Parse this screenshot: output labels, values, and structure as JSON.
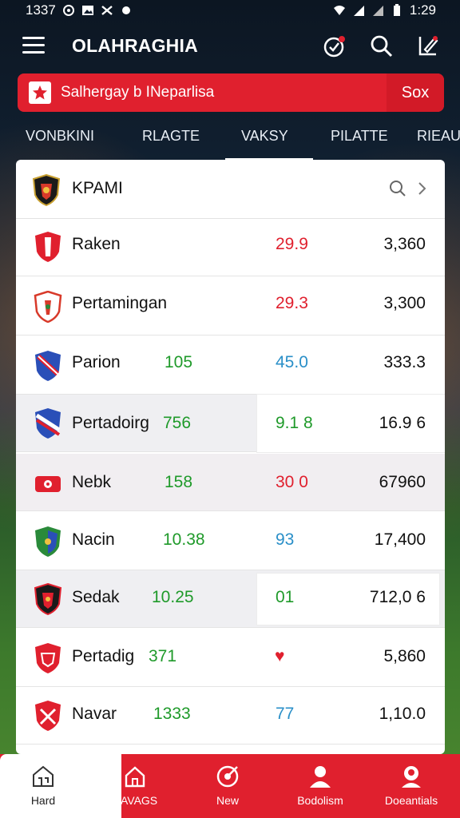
{
  "status_bar": {
    "time_left": "1337",
    "time_right": "1:29"
  },
  "app_bar": {
    "title": "OLAHRAGHIA"
  },
  "banner": {
    "text": "Salhergay b INeparlisa",
    "action": "Sox"
  },
  "tabs": [
    "VONBKINI",
    "RLAGTE",
    "VAKSY",
    "PILATTE",
    "RIEAU"
  ],
  "card_header": {
    "name": "KPAMI"
  },
  "rows": [
    {
      "team": "Raken",
      "v1": "",
      "v2": "29.9",
      "v3": "3,360",
      "v2_color": "red",
      "v3_color": "red"
    },
    {
      "team": "Pertamingan",
      "v1": "",
      "v2": "29.3",
      "v3": "3,300",
      "v2_color": "red",
      "v3_color": "green"
    },
    {
      "team": "Parion",
      "v1": "105",
      "v2": "45.0",
      "v3": "333.3",
      "v2_color": "blue",
      "v3_color": "black"
    },
    {
      "team": "Pertadoirg",
      "v1": "756",
      "v2": "9.1 8",
      "v3": "16.9 6",
      "v2_color": "green",
      "v3_color": "black"
    },
    {
      "team": "Nebk",
      "v1": "158",
      "v2": "30 0",
      "v3": "67960",
      "v2_color": "red",
      "v3_color": "black"
    },
    {
      "team": "Nacin",
      "v1": "10.38",
      "v2": "93",
      "v3": "17,400",
      "v2_color": "blue",
      "v3_color": "black"
    },
    {
      "team": "Sedak",
      "v1": "10.25",
      "v2": "01",
      "v3": "712,0 6",
      "v2_color": "green",
      "v3_color": "black"
    },
    {
      "team": "Pertadig",
      "v1": "371",
      "v2": "♥",
      "v3": "5,860",
      "v2_color": "red",
      "v3_color": "black"
    },
    {
      "team": "Navar",
      "v1": "1333",
      "v2": "77",
      "v3": "1,10.0",
      "v2_color": "blue",
      "v3_color": "green"
    }
  ],
  "bottom_nav": [
    {
      "label": "Hard",
      "icon": "home-icon"
    },
    {
      "label": "NAVAGS",
      "icon": "home-outline-icon"
    },
    {
      "label": "New",
      "icon": "target-icon"
    },
    {
      "label": "Bodolism",
      "icon": "person-icon"
    },
    {
      "label": "Doeantials",
      "icon": "person-circle-icon"
    }
  ],
  "colors": {
    "accent": "#e0202e",
    "green": "#1f9a2a",
    "blue": "#2a8fc8"
  }
}
